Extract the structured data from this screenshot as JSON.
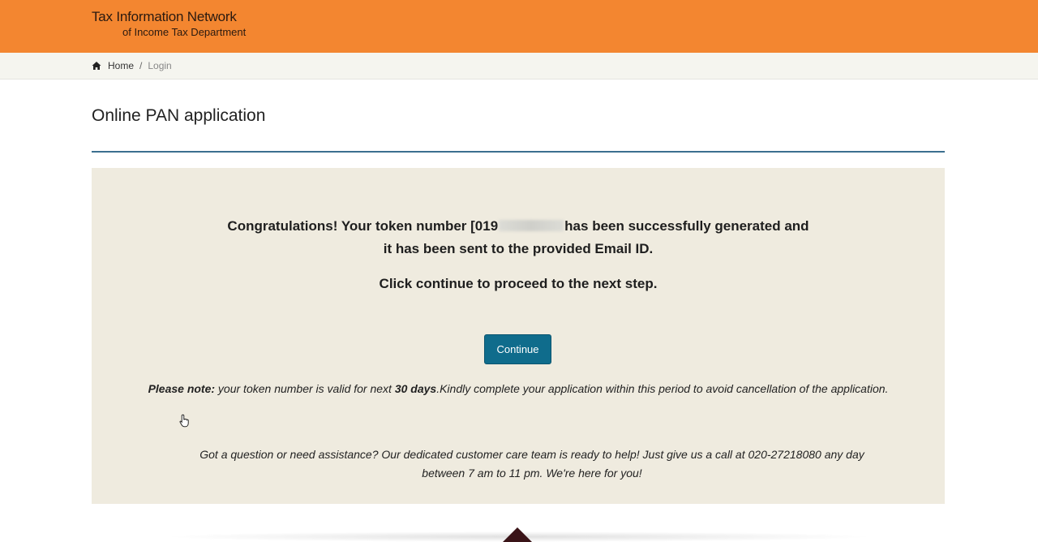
{
  "header": {
    "logo_line1": "Tax Information Network",
    "logo_line2": "of Income Tax Department",
    "background_color": "#f38630"
  },
  "breadcrumb": {
    "home_icon": "home-icon",
    "home_label": "Home",
    "separator": "/",
    "current_label": "Login"
  },
  "page": {
    "title": "Online PAN application"
  },
  "panel": {
    "congrats_prefix": "Congratulations! Your token number [019",
    "congrats_suffix": "has been successfully generated and",
    "congrats_line2": "it has been sent to the provided Email ID.",
    "next_step": "Click continue to proceed to the next step.",
    "continue_label": "Continue",
    "note_label": "Please note:",
    "note_text_1": " your token number is valid for next ",
    "note_days": "30 days",
    "note_text_2": ".Kindly complete your application within this period to avoid cancellation of the application.",
    "help_line1": "Got a question or need assistance? Our dedicated customer care team is ready to help! Just give us a call at 020-27218080 any day",
    "help_line2": "between 7 am to 11 pm. We're here for you!",
    "background_color": "#efebdf",
    "button_color": "#0f6c8c"
  }
}
